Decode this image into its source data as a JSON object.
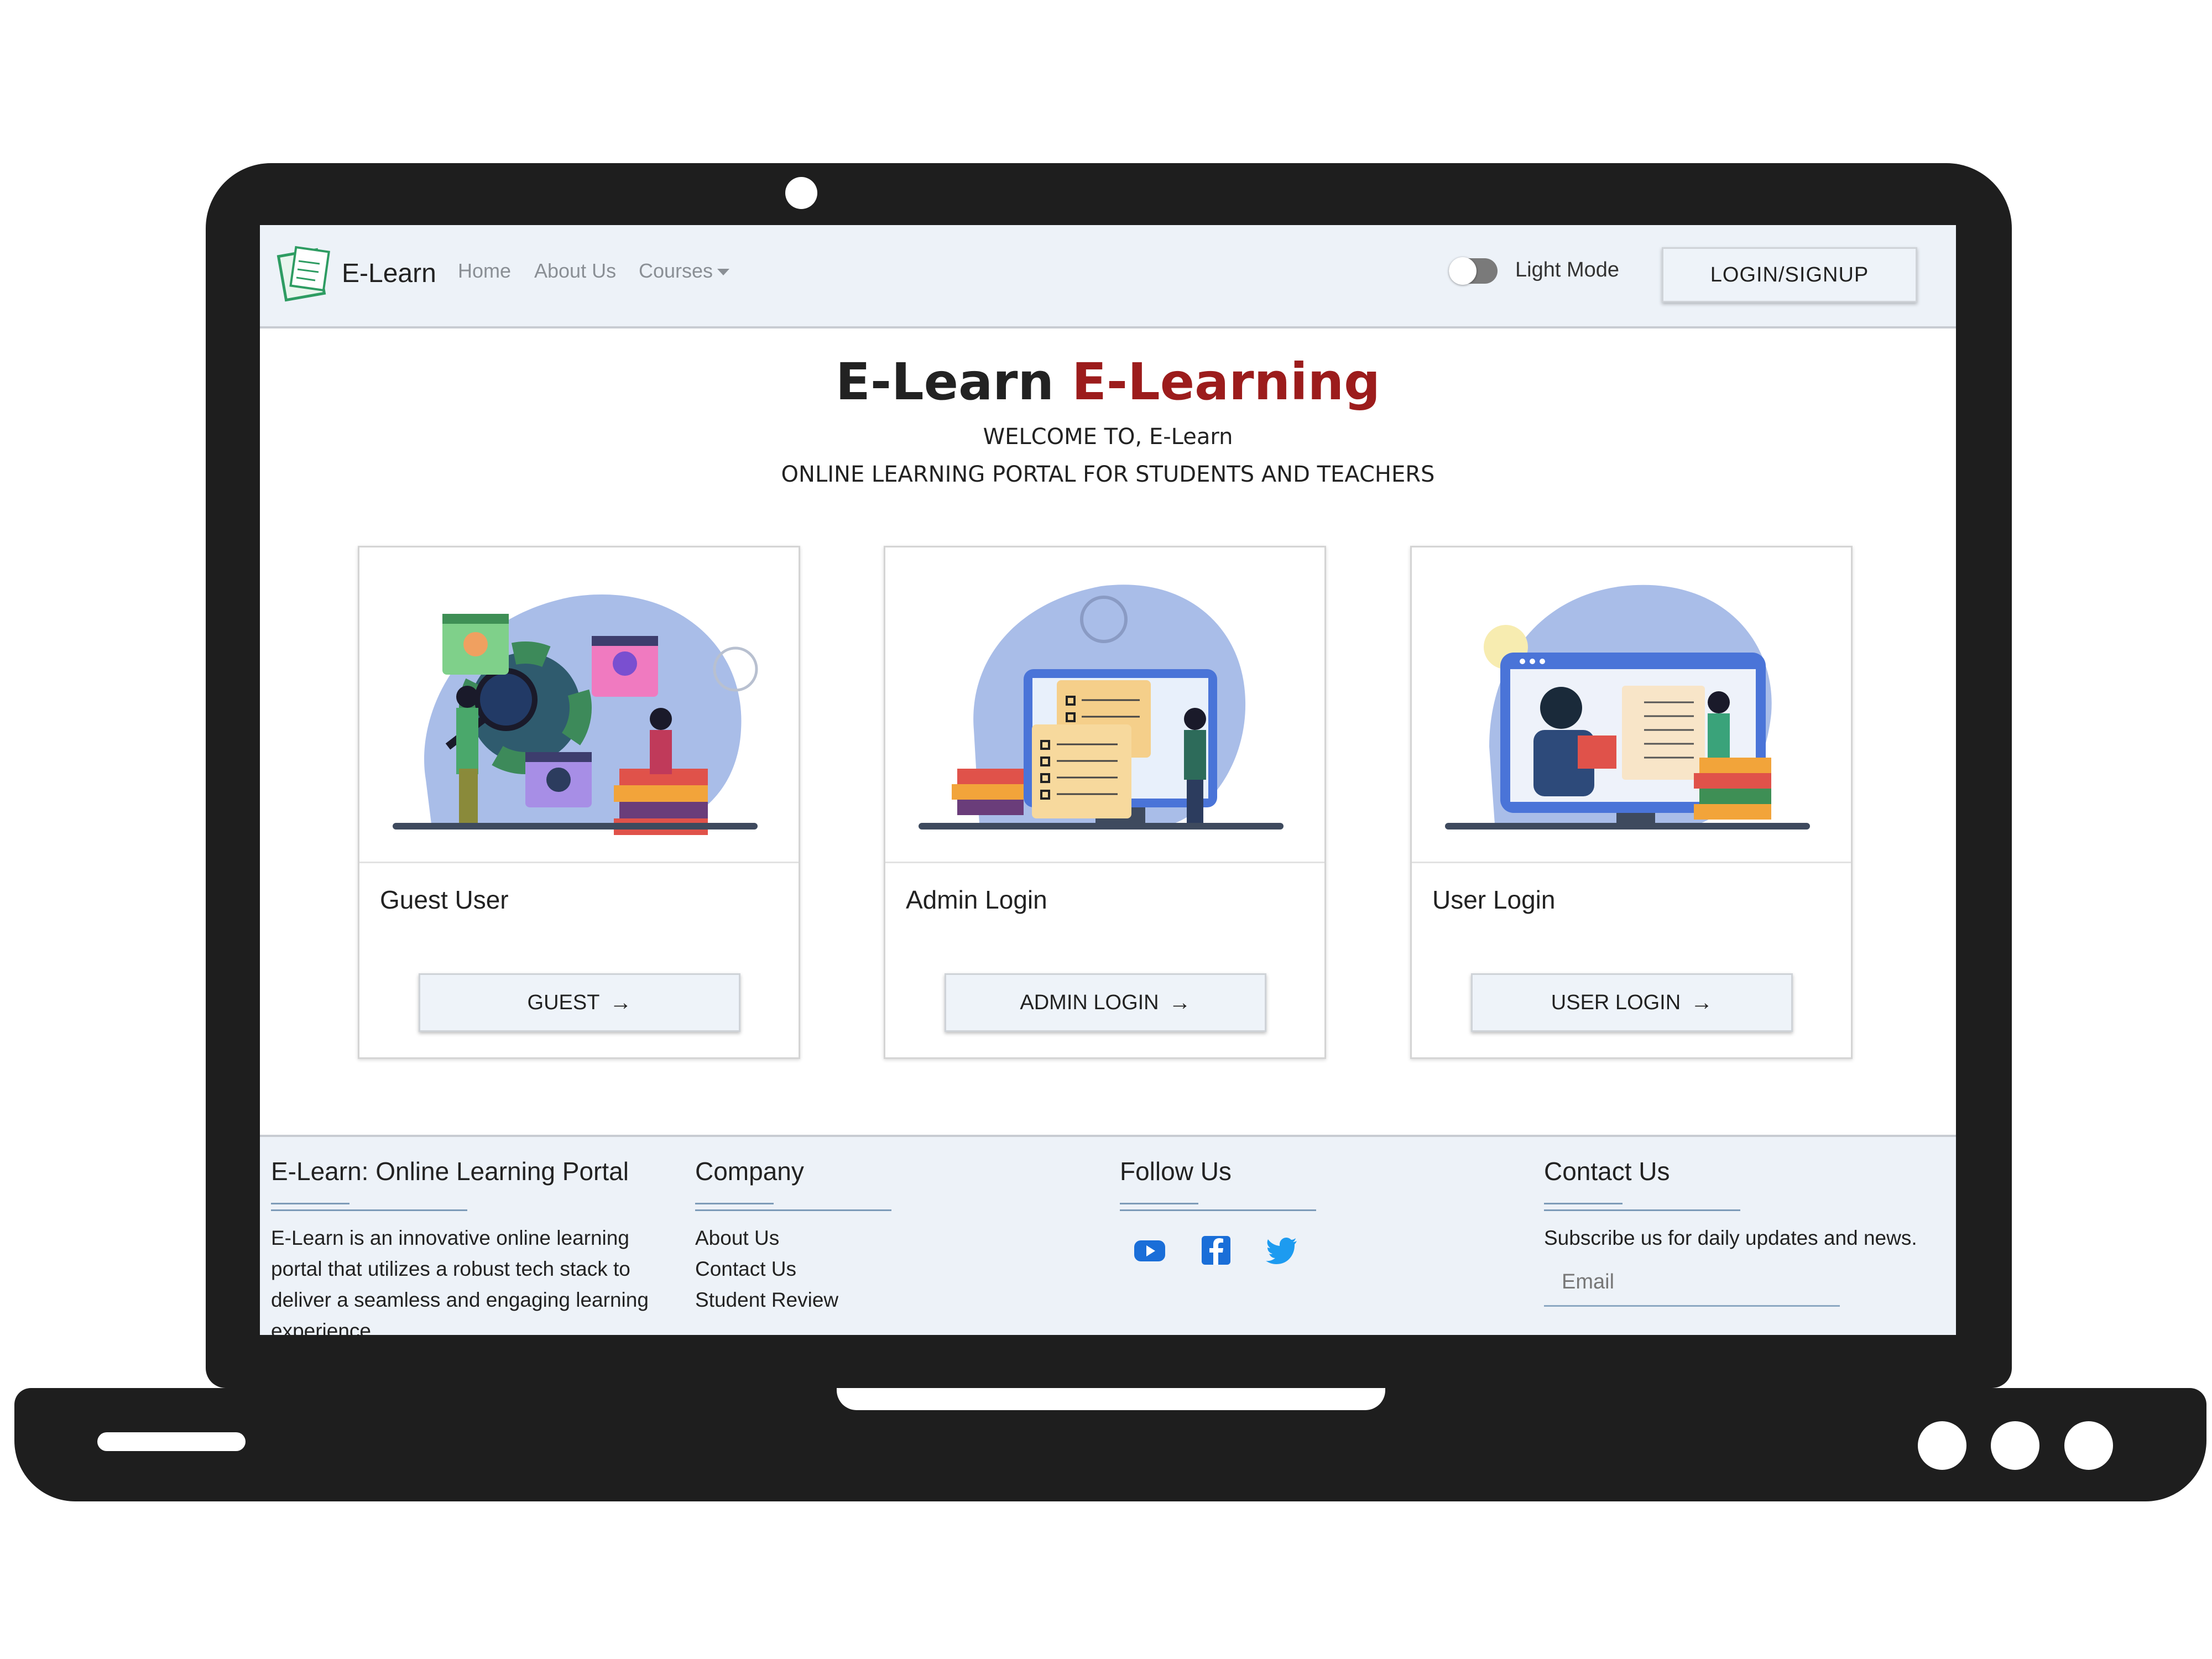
{
  "navbar": {
    "brand": "E-Learn",
    "links": {
      "home": "Home",
      "about": "About Us",
      "courses": "Courses"
    },
    "mode_label": "Light Mode",
    "login_button": "LOGIN/SIGNUP"
  },
  "hero": {
    "title_main": "E-Learn",
    "title_accent": "E-Learning",
    "welcome": "WELCOME TO, E-Learn",
    "tagline": "ONLINE LEARNING PORTAL FOR STUDENTS AND TEACHERS"
  },
  "cards": [
    {
      "title": "Guest User",
      "button": "GUEST"
    },
    {
      "title": "Admin Login",
      "button": "ADMIN LOGIN"
    },
    {
      "title": "User Login",
      "button": "USER LOGIN"
    }
  ],
  "footer": {
    "about": {
      "heading": "E-Learn: Online Learning Portal",
      "text": "E-Learn is an innovative online learning portal that utilizes a robust tech stack to deliver a seamless and engaging learning experience."
    },
    "company": {
      "heading": "Company",
      "links": [
        "About Us",
        "Contact Us",
        "Student Review"
      ]
    },
    "follow": {
      "heading": "Follow Us"
    },
    "contact": {
      "heading": "Contact Us",
      "text": "Subscribe us for daily updates and news.",
      "email_placeholder": "Email"
    }
  },
  "colors": {
    "accent": "#9c1c1c",
    "navbar_bg": "#edf2f8",
    "youtube": "#1a6ed8",
    "facebook": "#1a6ed8",
    "twitter": "#1d9bf0"
  },
  "icons": [
    "e-learn-logo-icon",
    "youtube-icon",
    "facebook-icon",
    "twitter-icon",
    "arrow-right-icon",
    "chevron-down-icon"
  ]
}
